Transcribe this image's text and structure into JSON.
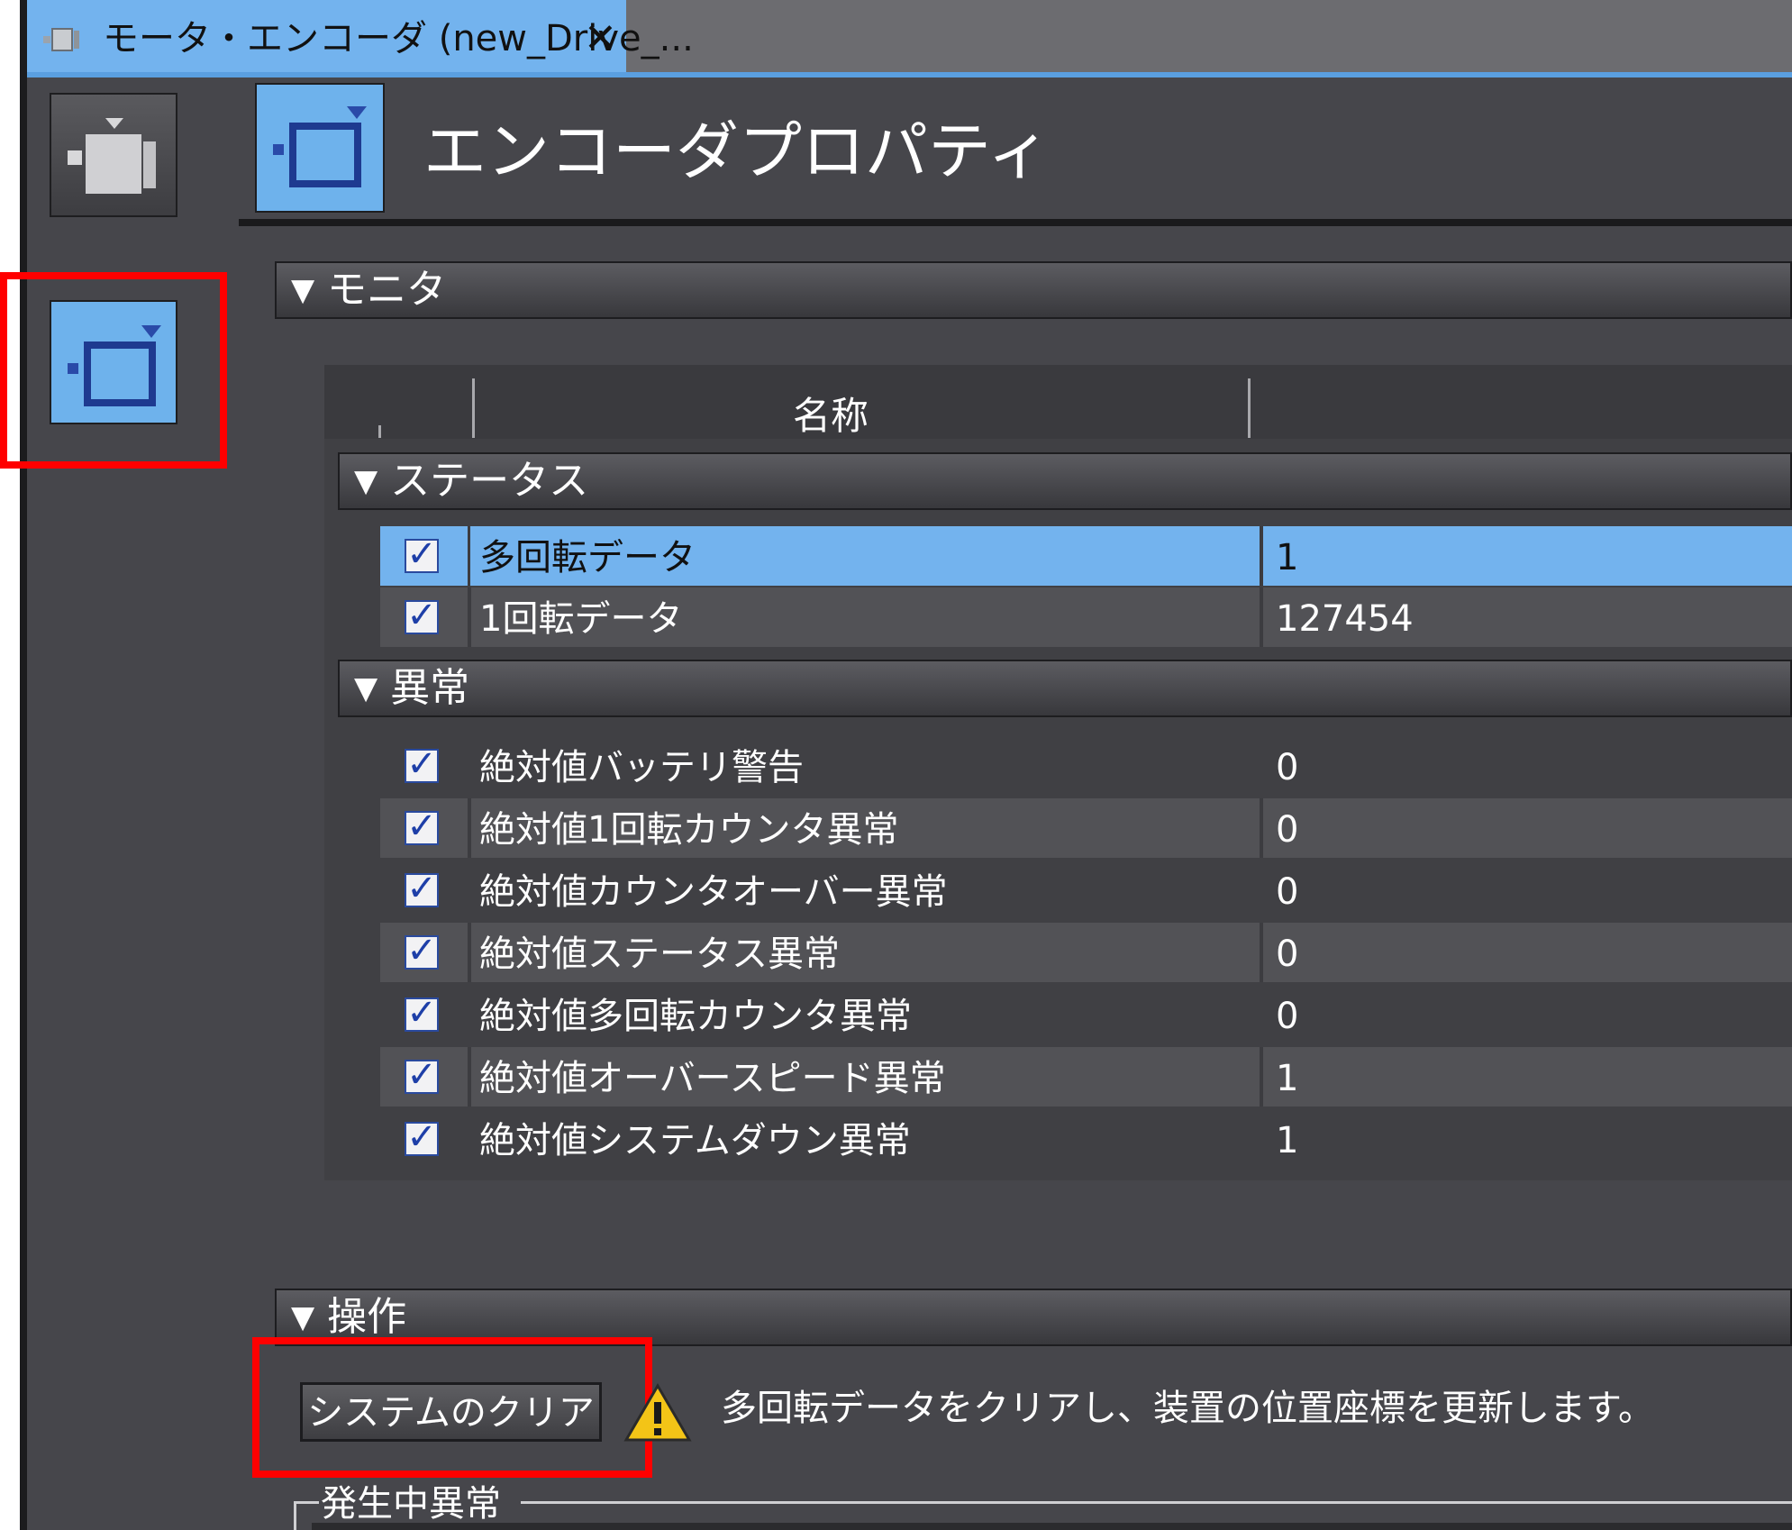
{
  "tab": {
    "title": "モータ・エンコーダ (new_Drive_...",
    "close": "✕"
  },
  "header": {
    "title": "エンコーダプロパティ"
  },
  "monitor": {
    "label": "モニタ",
    "column_name": "名称",
    "status_group": {
      "label": "ステータス",
      "rows": [
        {
          "name": "多回転データ",
          "value": "1",
          "checked": true,
          "selected": true
        },
        {
          "name": "1回転データ",
          "value": "127454",
          "checked": true,
          "selected": false
        }
      ]
    },
    "error_group": {
      "label": "異常",
      "rows": [
        {
          "name": "絶対値バッテリ警告",
          "value": "0",
          "checked": true
        },
        {
          "name": "絶対値1回転カウンタ異常",
          "value": "0",
          "checked": true
        },
        {
          "name": "絶対値カウンタオーバー異常",
          "value": "0",
          "checked": true
        },
        {
          "name": "絶対値ステータス異常",
          "value": "0",
          "checked": true
        },
        {
          "name": "絶対値多回転カウンタ異常",
          "value": "0",
          "checked": true
        },
        {
          "name": "絶対値オーバースピード異常",
          "value": "1",
          "checked": true
        },
        {
          "name": "絶対値システムダウン異常",
          "value": "1",
          "checked": true
        }
      ]
    }
  },
  "operation": {
    "label": "操作",
    "clear_button": "システムのクリア",
    "message": "多回転データをクリアし、装置の位置座標を更新します。",
    "active_errors_label": "発生中異常"
  },
  "icons": {
    "tab": "device-tab-icon",
    "motor": "motor-icon",
    "encoder": "encoder-icon",
    "warning": "warning-icon",
    "expand": "triangle-down-icon",
    "checkbox": "checkbox-checked-icon"
  },
  "colors": {
    "selection": "#73b3ee",
    "highlight": "#ff0000",
    "background": "#46464b"
  }
}
